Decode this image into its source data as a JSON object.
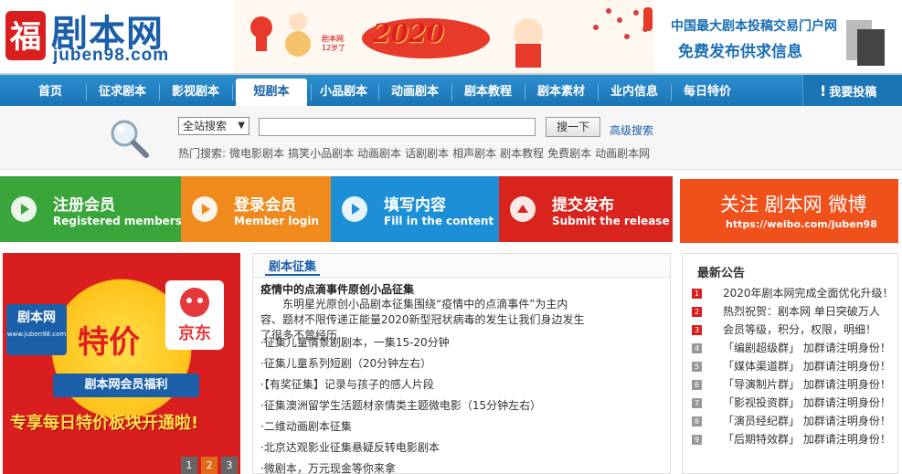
{
  "header": {
    "logo_name": "剧本网",
    "logo_domain": "juben98.com",
    "banner_year": "2020",
    "banner_small": "剧本网12岁了",
    "slogan_1": "中国最大剧本投稿交易门户网",
    "slogan_2": "免费发布供求信息"
  },
  "nav": {
    "items": [
      "首页",
      "征求剧本",
      "影视剧本",
      "短剧本",
      "小品剧本",
      "动画剧本",
      "剧本教程",
      "剧本素材",
      "业内信息",
      "每日特价"
    ],
    "active_index": 3,
    "contribute_label": "我要投稿"
  },
  "search": {
    "scope_value": "全站搜索",
    "input_value": "",
    "button_label": "搜一下",
    "advanced_label": "高级搜索",
    "hot_label": "热门搜索:",
    "hot_terms": [
      "微电影剧本",
      "搞笑小品剧本",
      "动画剧本",
      "话剧剧本",
      "相声剧本",
      "剧本教程",
      "免费剧本",
      "动画剧本网"
    ]
  },
  "actions": [
    {
      "title": "注册会员",
      "subtitle": "Registered members",
      "color": "#3aa53a"
    },
    {
      "title": "登录会员",
      "subtitle": "Member login",
      "color": "#f08a1c"
    },
    {
      "title": "填写内容",
      "subtitle": "Fill in the content",
      "color": "#1d8fd6"
    },
    {
      "title": "提交发布",
      "subtitle": "Submit the release",
      "color": "#d8241c"
    }
  ],
  "follow": {
    "line1": "关注  剧本网  微博",
    "line2": "https://weibo.com/juben98"
  },
  "promo": {
    "juben_logo": "剧本网",
    "juben_domain": "www.juben98.com",
    "jd": "京东",
    "tejia": "特价",
    "ribbon": "剧本网会员福利",
    "bottom": "专享每日特价板块开通啦!",
    "pages": [
      "1",
      "2",
      "3"
    ],
    "active_page": 1
  },
  "center": {
    "tab": "剧本征集",
    "feature_title": "疫情中的点滴事件原创小品征集",
    "feature_desc": "东明星光原创小品剧本征集围绕“疫情中的点滴事件”为主内容、题材不限传递正能量2020新型冠状病毒的发生让我们身边发生了很多不曾经历..",
    "items": [
      "·征集儿童情景剧剧本，一集15-20分钟",
      "·征集儿童系列短剧（20分钟左右）",
      "·【有奖征集】记录与孩子的感人片段",
      "·征集澳洲留学生活题材亲情类主题微电影（15分钟左右）",
      "·二维动画剧本征集",
      "·北京达观影业征集悬疑反转电影剧本",
      "·微剧本，万元现金等你来拿"
    ]
  },
  "notice": {
    "title": "最新公告",
    "items": [
      {
        "num": "1",
        "text": "2020年剧本网完成全面优化升级！"
      },
      {
        "num": "2",
        "text": "热烈祝贺：剧本网 单日突破万人"
      },
      {
        "num": "3",
        "text": "会员等级，积分，权限，明细！"
      },
      {
        "num": "4",
        "text": "「编剧超级群」 加群请注明身份！"
      },
      {
        "num": "5",
        "text": "「媒体渠道群」 加群请注明身份！"
      },
      {
        "num": "6",
        "text": "「导演制片群」 加群请注明身份！"
      },
      {
        "num": "7",
        "text": "「影视投资群」 加群请注明身份！"
      },
      {
        "num": "8",
        "text": "「演员经纪群」 加群请注明身份！"
      },
      {
        "num": "9",
        "text": "「后期特效群」 加群请注明身份！"
      }
    ]
  }
}
